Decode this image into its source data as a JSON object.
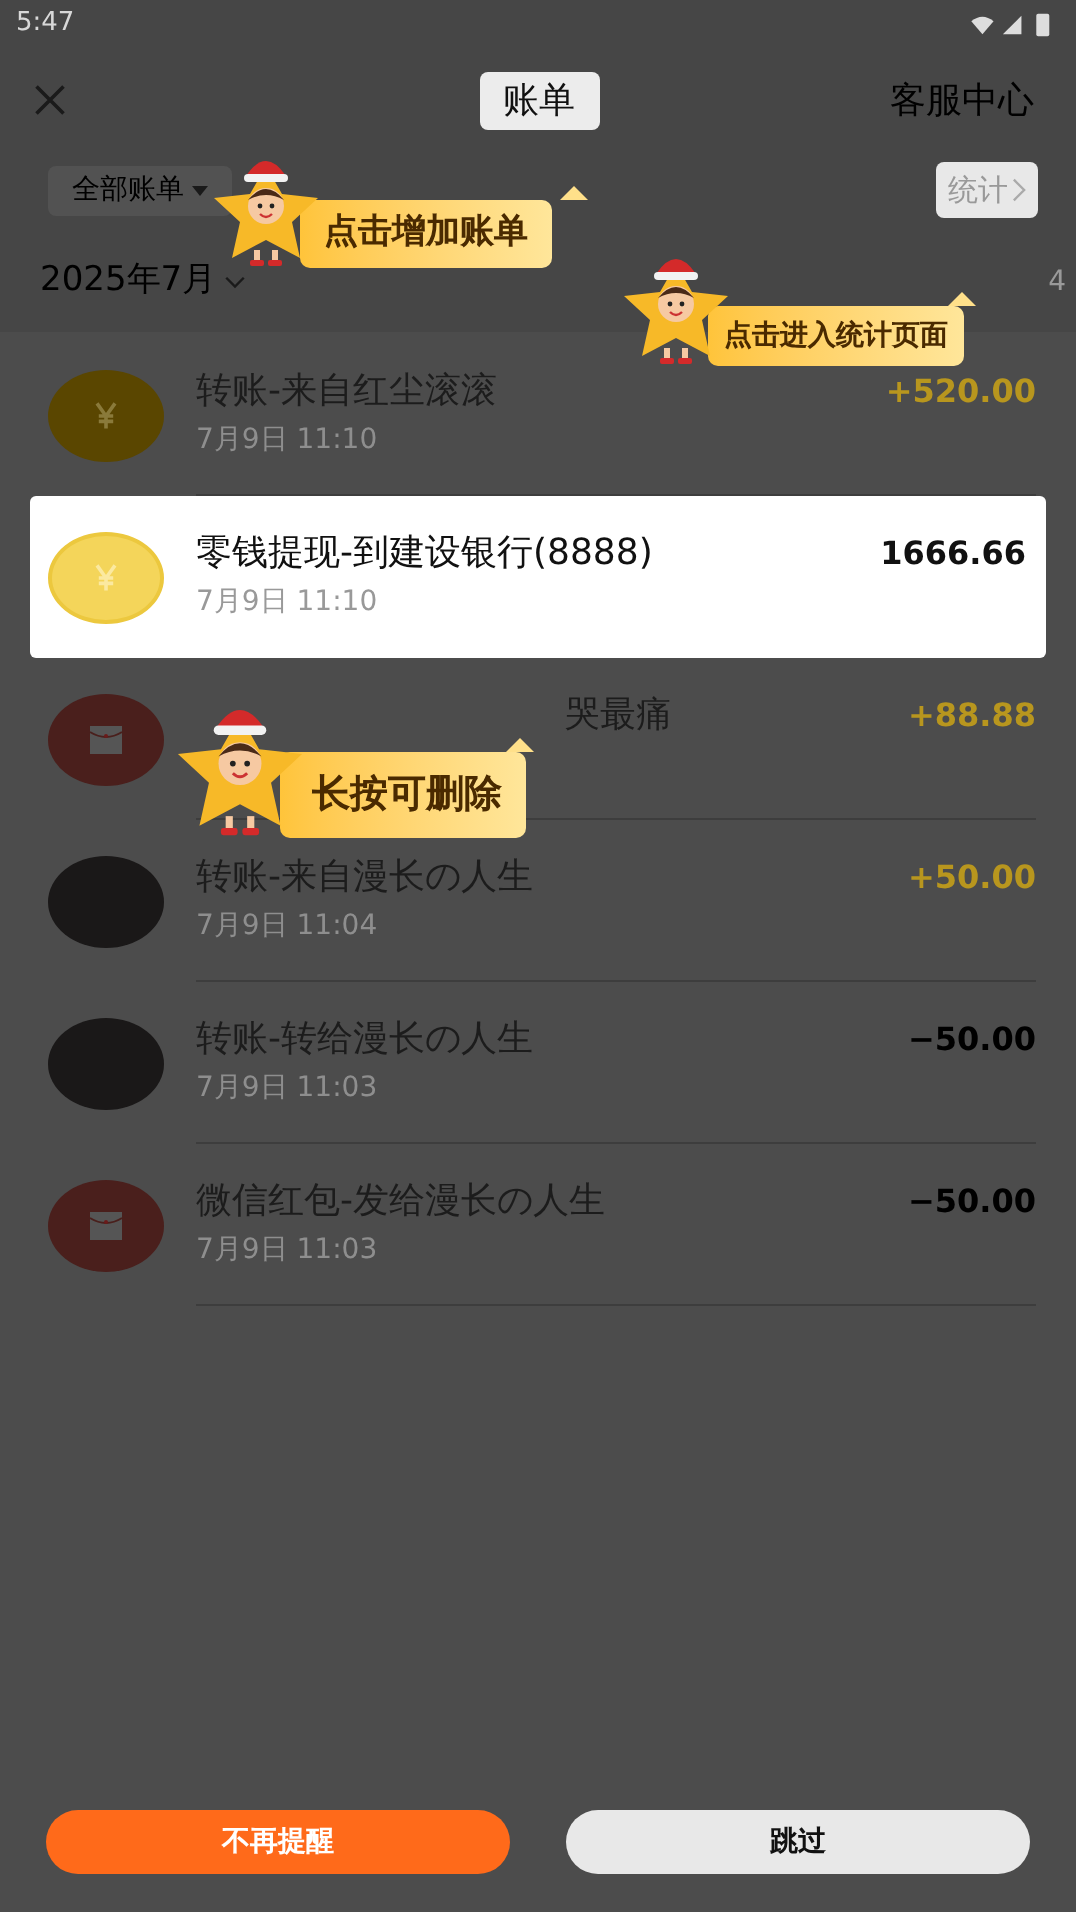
{
  "status_bar": {
    "time": "5:47"
  },
  "header": {
    "title": "账单",
    "title_highlighted": true,
    "right_link": "客服中心"
  },
  "filter": {
    "label": "全部账单"
  },
  "stats_button": {
    "label": "统计",
    "highlighted": true
  },
  "month": {
    "label": "2025年7月",
    "summary_fragment": "4"
  },
  "transactions": [
    {
      "kind": "coin",
      "title": "转账-来自红尘滚滚",
      "date": "7月9日 11:10",
      "amount": "+520.00",
      "color": "#b8961e",
      "highlighted": false,
      "covered": false
    },
    {
      "kind": "coin",
      "title": "零钱提现-到建设银行(8888)",
      "date": "7月9日 11:10",
      "amount": "1666.66",
      "color": "#111111",
      "highlighted": true,
      "covered": false
    },
    {
      "kind": "envelope",
      "title": "哭最痛",
      "amount": "+88.88",
      "color": "#b8961e",
      "highlighted": false,
      "covered": true
    },
    {
      "kind": "photo",
      "title": "转账-来自漫长の人生",
      "date": "7月9日 11:04",
      "amount": "+50.00",
      "color": "#b8961e",
      "highlighted": false,
      "covered": false
    },
    {
      "kind": "photo",
      "title": "转账-转给漫长の人生",
      "date": "7月9日 11:03",
      "amount": "−50.00",
      "color": "#000000",
      "highlighted": false,
      "covered": false
    },
    {
      "kind": "envelope",
      "title": "微信红包-发给漫长の人生",
      "date": "7月9日 11:03",
      "amount": "−50.00",
      "color": "#000000",
      "highlighted": false,
      "covered": false
    }
  ],
  "tips": [
    {
      "text": "点击增加账单"
    },
    {
      "text": "点击进入统计页面"
    },
    {
      "text": "长按可删除"
    }
  ],
  "buttons": [
    {
      "label": "不再提醒",
      "kind": "primary"
    },
    {
      "label": "跳过",
      "kind": "secondary"
    }
  ]
}
